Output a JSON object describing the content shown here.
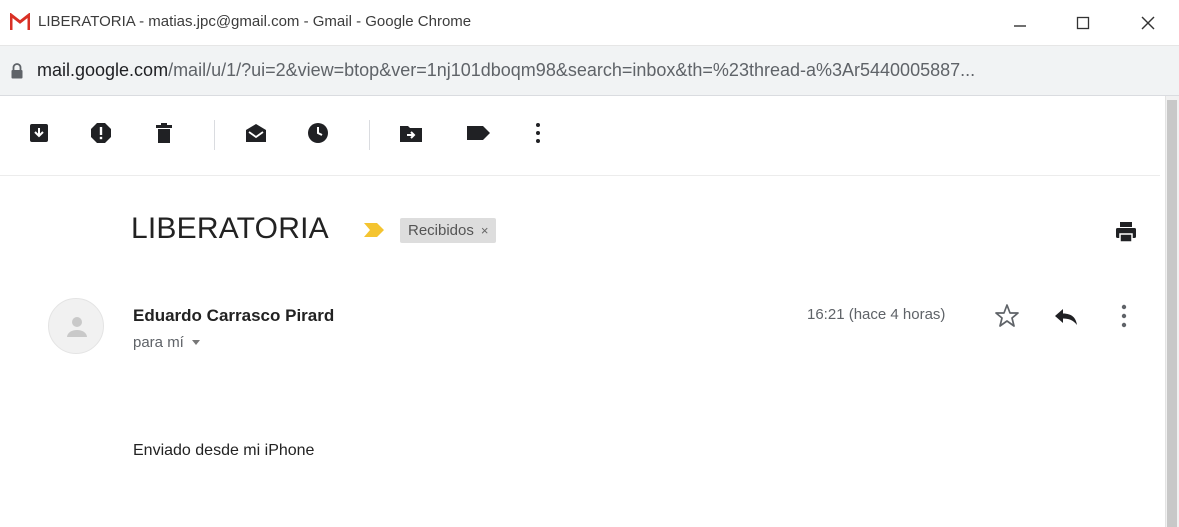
{
  "window": {
    "title": "LIBERATORIA - matias.jpc@gmail.com - Gmail - Google Chrome",
    "minimize_label": "—",
    "maximize_label": "☐",
    "close_label": "✕"
  },
  "address_bar": {
    "host": "mail.google.com",
    "path": "/mail/u/1/?ui=2&view=btop&ver=1nj101dboqm98&search=inbox&th=%23thread-a%3Ar5440005887..."
  },
  "toolbar": {
    "icons": [
      "archive-icon",
      "report-spam-icon",
      "delete-icon",
      "mark-unread-icon",
      "snooze-icon",
      "move-to-icon",
      "label-icon",
      "more-vert-icon"
    ]
  },
  "message": {
    "subject": "LIBERATORIA",
    "label_chip": "Recibidos",
    "label_chip_remove": "×",
    "sender": "Eduardo Carrasco Pirard",
    "recipient": "para mí",
    "timestamp": "16:21 (hace 4 horas)",
    "body": "Enviado desde mi iPhone"
  },
  "colors": {
    "gmail_red": "#d93025",
    "importance_yellow": "#f4c430",
    "icon_dark": "#202124",
    "chip_bg": "#dddddd"
  }
}
